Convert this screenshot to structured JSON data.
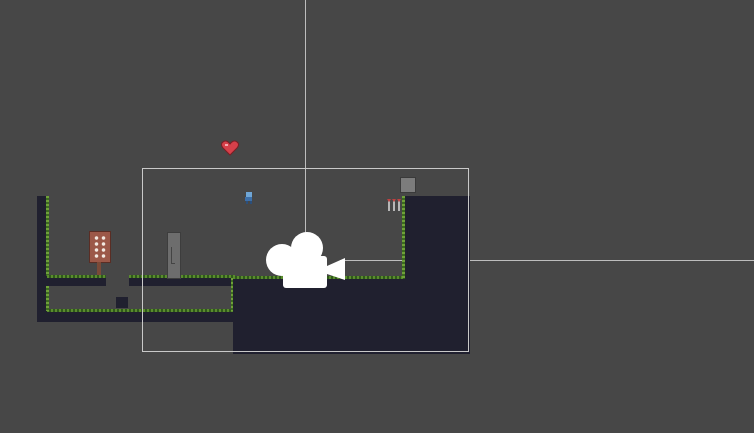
{
  "scene": {
    "background_color": "#474747",
    "tile_color": "#20202f",
    "grass_color": "#5a8c2e",
    "guide_color": "#bdbdbd",
    "camera_bounds_color": "#c9c9c9"
  },
  "icons": {
    "heart": "heart-icon",
    "player": "player-character-icon",
    "camera": "camera-gizmo-icon",
    "arrows": "arrow-trap-icon"
  }
}
